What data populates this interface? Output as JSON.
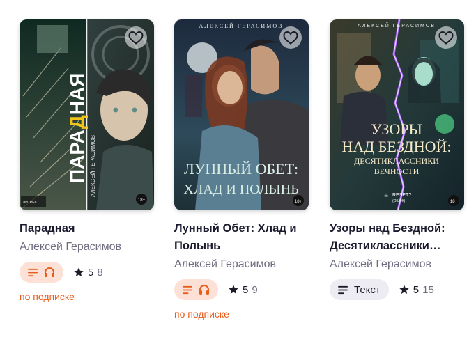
{
  "colors": {
    "accent": "#e85d1c",
    "title": "#1a1a2e",
    "muted": "#6e6e80"
  },
  "books": [
    {
      "title": "Парадная",
      "author": "Алексей Герасимов",
      "format_icons": [
        "text-lines-icon",
        "headphones-icon"
      ],
      "rating": "5",
      "rating_count": "8",
      "subscription": "по подписке",
      "cover": {
        "big": "ПАРАДНАЯ",
        "author": "АЛЕКСЕЙ ГЕРАСИМОВ",
        "age": "18+",
        "publisher": "ЛИТРЕС"
      }
    },
    {
      "title": "Лунный Обет: Хлад и Полынь",
      "author": "Алексей Герасимов",
      "format_icons": [
        "text-lines-icon",
        "headphones-icon"
      ],
      "rating": "5",
      "rating_count": "9",
      "subscription": "по подписке",
      "cover": {
        "top": "АЛЕКСЕЙ ГЕРАСИМОВ",
        "line1": "ЛУННЫЙ ОБЕТ:",
        "line2": "ХЛАД И ПОЛЫНЬ",
        "age": "18+"
      }
    },
    {
      "title": "Узоры над Бездной: Десятиклассники Вечности",
      "author": "Алексей Герасимов",
      "format_label": "Текст",
      "rating": "5",
      "rating_count": "15",
      "cover": {
        "top": "АЛЕКСЕЙ ГЕРАСИМОВ",
        "line1": "УЗОРЫ",
        "line2": "НАД БЕЗДНОЙ:",
        "line3": "ДЕСЯТИКЛАССНИКИ",
        "line4": "ВЕЧНОСТИ",
        "reset": "RESET?",
        "reset_sub": "(ОК/ОК)",
        "age": "18+"
      }
    }
  ]
}
